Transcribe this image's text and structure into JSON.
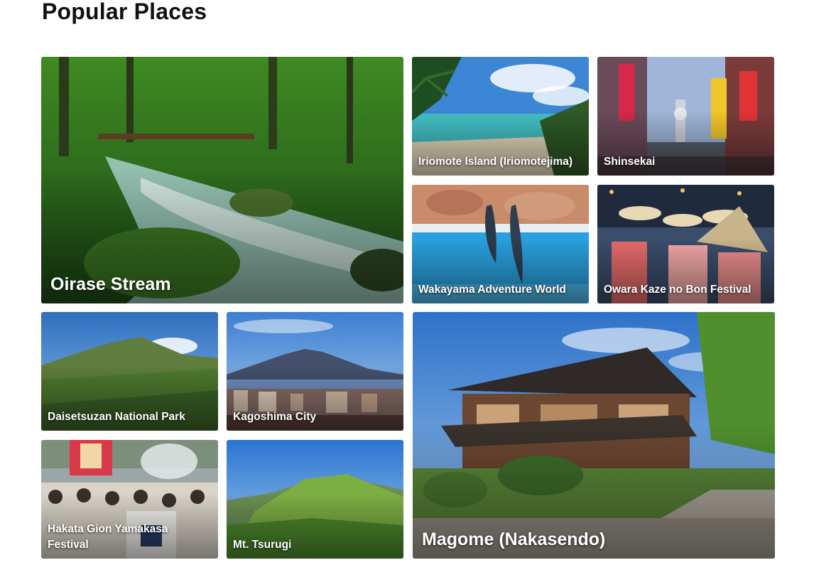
{
  "section": {
    "title": "Popular Places"
  },
  "places": [
    {
      "name": "Oirase Stream"
    },
    {
      "name": "Iriomote Island (Iriomotejima)"
    },
    {
      "name": "Shinsekai"
    },
    {
      "name": "Wakayama Adventure World"
    },
    {
      "name": "Owara Kaze no Bon Festival"
    },
    {
      "name": "Daisetsuzan National Park"
    },
    {
      "name": "Kagoshima City"
    },
    {
      "name": "Magome (Nakasendo)"
    },
    {
      "name": "Hakata Gion Yamakasa Festival"
    },
    {
      "name": "Mt. Tsurugi"
    }
  ]
}
